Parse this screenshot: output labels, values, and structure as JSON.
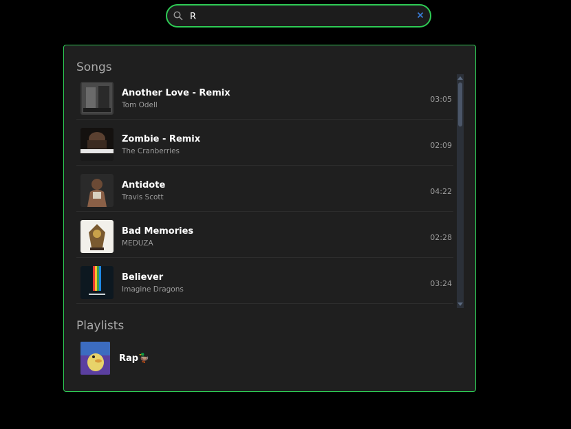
{
  "search": {
    "value": "R",
    "placeholder": ""
  },
  "sections": {
    "songs_title": "Songs",
    "playlists_title": "Playlists"
  },
  "songs": [
    {
      "title": "Another Love - Remix",
      "artist": "Tom Odell",
      "duration": "03:05",
      "cover_icon": "album-cover-dark-photo"
    },
    {
      "title": "Zombie - Remix",
      "artist": "The Cranberries",
      "duration": "02:09",
      "cover_icon": "album-cover-trendingsmusik"
    },
    {
      "title": "Antidote",
      "artist": "Travis Scott",
      "duration": "04:22",
      "cover_icon": "album-cover-portrait"
    },
    {
      "title": "Bad Memories",
      "artist": "MEDUZA",
      "duration": "02:28",
      "cover_icon": "album-cover-illustration"
    },
    {
      "title": "Believer",
      "artist": "Imagine Dragons",
      "duration": "03:24",
      "cover_icon": "album-cover-imagine-dragons"
    }
  ],
  "playlists": [
    {
      "name": "Rap🦆",
      "cover_icon": "playlist-cover-duck"
    }
  ],
  "colors": {
    "accent": "#2ecc55",
    "panel": "#1f1f1f",
    "clear": "#3a7bd5"
  }
}
